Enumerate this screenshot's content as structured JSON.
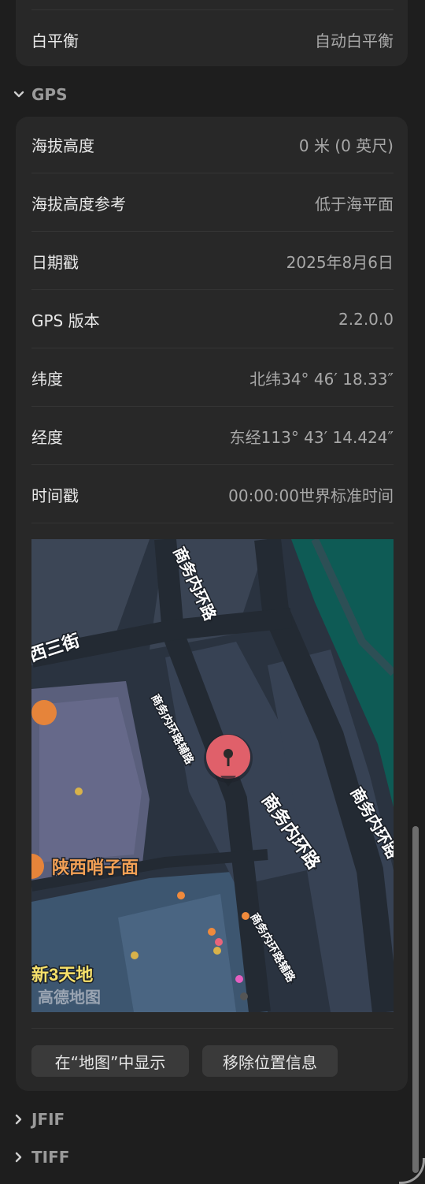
{
  "top_row": {
    "label": "白平衡",
    "value": "自动白平衡"
  },
  "gps": {
    "header": "GPS",
    "rows": [
      {
        "label": "海拔高度",
        "value": "0 米 (0 英尺)"
      },
      {
        "label": "海拔高度参考",
        "value": "低于海平面"
      },
      {
        "label": "日期戳",
        "value": "2025年8月6日"
      },
      {
        "label": "GPS 版本",
        "value": "2.2.0.0"
      },
      {
        "label": "纬度",
        "value": "北纬34° 46′ 18.33″"
      },
      {
        "label": "经度",
        "value": "东经113° 43′ 14.424″"
      },
      {
        "label": "时间戳",
        "value": "00:00:00世界标准时间"
      }
    ],
    "map": {
      "labels": [
        "商务内环路",
        "西三街",
        "商务内环路辅路",
        "商务内环路",
        "陕西哨子面",
        "商务内环路辅路",
        "商务内环路",
        "新3天地",
        "高德地图"
      ]
    },
    "buttons": {
      "show_in_maps": "在“地图”中显示",
      "remove_location": "移除位置信息"
    }
  },
  "sections": [
    {
      "label": "JFIF"
    },
    {
      "label": "TIFF"
    }
  ],
  "colors": {
    "accent_pin": "#e0606a",
    "water": "#0d5c55",
    "road": "#2f3a45"
  }
}
